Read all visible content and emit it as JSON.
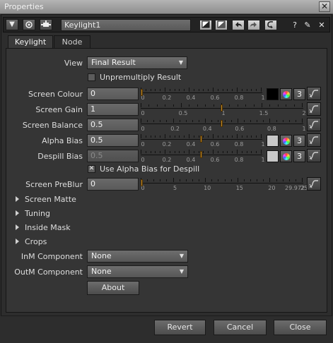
{
  "window": {
    "title": "Properties",
    "close_glyph": "✕"
  },
  "header": {
    "collapse_glyph": "▼",
    "node_name": "Keylight1",
    "help_glyph": "?",
    "float_glyph": "✎",
    "restore_glyph": "◱",
    "close_glyph": "✕"
  },
  "tabs": [
    {
      "label": "Keylight",
      "active": true
    },
    {
      "label": "Node",
      "active": false
    }
  ],
  "view": {
    "label": "View",
    "value": "Final Result"
  },
  "unpremultiply": {
    "label": "Unpremultiply Result",
    "checked": false
  },
  "params": [
    {
      "label": "Screen Colour",
      "value": "0",
      "disabled": false,
      "ticks": [
        "0",
        "0.2",
        "0.4",
        "0.6",
        "0.8",
        "1"
      ],
      "knob": 0.0,
      "swatch": "#000000",
      "count": "3",
      "wheel": true
    },
    {
      "label": "Screen Gain",
      "value": "1",
      "disabled": false,
      "ticks": [
        "0",
        "0.5",
        "1",
        "1.5",
        "2"
      ],
      "knob": 0.5,
      "swatch": null,
      "count": null,
      "wheel": false
    },
    {
      "label": "Screen Balance",
      "value": "0.5",
      "disabled": false,
      "ticks": [
        "0",
        "0.2",
        "0.4",
        "0.6",
        "0.8",
        "1"
      ],
      "knob": 0.5,
      "swatch": null,
      "count": null,
      "wheel": false
    },
    {
      "label": "Alpha Bias",
      "value": "0.5",
      "disabled": false,
      "ticks": [
        "0",
        "0.2",
        "0.4",
        "0.6",
        "0.8",
        "1"
      ],
      "knob": 0.5,
      "swatch": "#c8c8c8",
      "count": "3",
      "wheel": true
    },
    {
      "label": "Despill Bias",
      "value": "0.5",
      "disabled": true,
      "ticks": [
        "0",
        "0.2",
        "0.4",
        "0.6",
        "0.8",
        "1"
      ],
      "knob": 0.5,
      "swatch": "#c8c8c8",
      "count": "3",
      "wheel": true
    }
  ],
  "use_alpha_bias": {
    "label": "Use Alpha Bias for Despill",
    "checked": true
  },
  "preblur": {
    "label": "Screen PreBlur",
    "value": "0",
    "ticks": [
      "0",
      "5",
      "10",
      "15",
      "20",
      "25"
    ],
    "end_label": "29.972",
    "knob": 0.0
  },
  "groups": [
    "Screen Matte",
    "Tuning",
    "Inside Mask",
    "Crops"
  ],
  "inm": {
    "label": "InM Component",
    "value": "None"
  },
  "outm": {
    "label": "OutM Component",
    "value": "None"
  },
  "about_label": "About",
  "footer": {
    "revert": "Revert",
    "cancel": "Cancel",
    "close": "Close"
  }
}
